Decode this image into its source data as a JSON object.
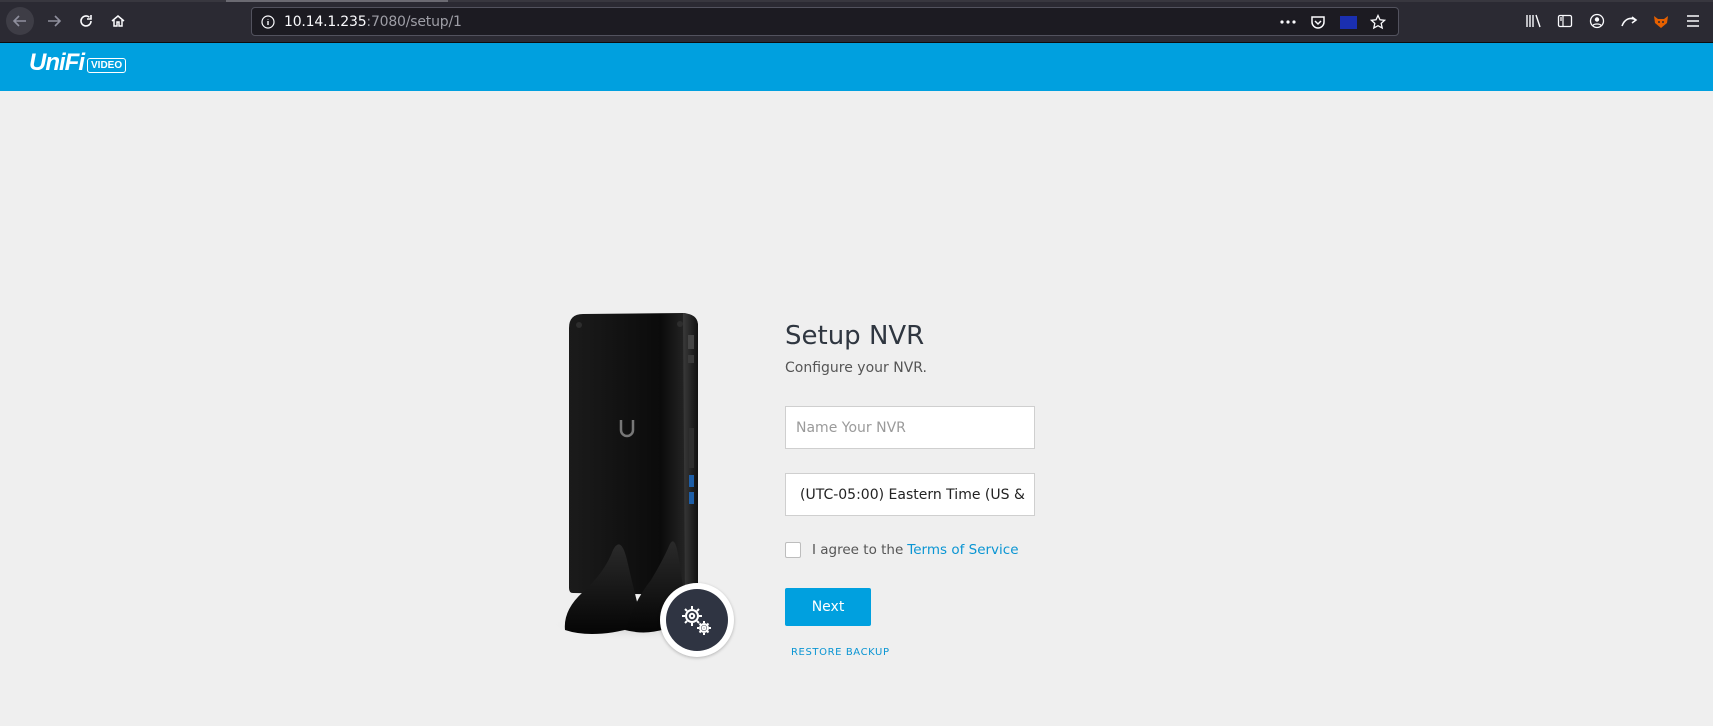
{
  "browser": {
    "url_host": "10.14.1.235",
    "url_rest": ":7080/setup/1",
    "icons": {
      "back": "back-arrow-icon",
      "forward": "forward-arrow-icon",
      "reload": "reload-icon",
      "home": "home-icon",
      "info": "site-info-icon",
      "more": "page-actions-icon",
      "pocket": "pocket-icon",
      "flag": "extension-flag-icon",
      "bookmark": "bookmark-star-icon",
      "library": "library-icon",
      "sidebar": "sidebar-icon",
      "account": "account-icon",
      "sync": "sync-icon",
      "fox": "fox-extension-icon",
      "menu": "hamburger-menu-icon"
    }
  },
  "header": {
    "logo_text": "UniFi",
    "logo_badge": "VIDEO",
    "brand_color": "#00a0df"
  },
  "setup": {
    "title": "Setup NVR",
    "subtitle": "Configure your NVR.",
    "name_placeholder": "Name Your NVR",
    "name_value": "",
    "timezone_value": "(UTC-05:00) Eastern Time (US &",
    "tos_prefix": "I agree to the",
    "tos_link": "Terms of Service",
    "tos_checked": false,
    "next_label": "Next",
    "restore_label": "RESTORE BACKUP",
    "accent_color": "#00a0df",
    "link_color": "#0a95d3"
  }
}
